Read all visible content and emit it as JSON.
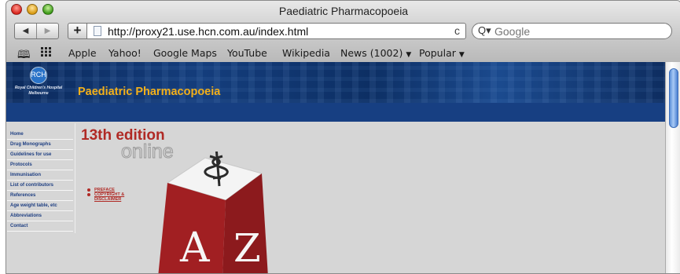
{
  "window": {
    "title": "Paediatric Pharmacopoeia"
  },
  "toolbar": {
    "back_icon": "back-arrow-icon",
    "forward_icon": "forward-arrow-icon",
    "add_label": "+",
    "url": "http://proxy21.use.hcn.com.au/index.html",
    "reload_glyph": "c",
    "search_placeholder": "Google"
  },
  "bookmarks": {
    "items": [
      {
        "label": "Apple"
      },
      {
        "label": "Yahoo!"
      },
      {
        "label": "Google Maps"
      },
      {
        "label": "YouTube"
      },
      {
        "label": "Wikipedia"
      },
      {
        "label": "News (1002)",
        "menu": true
      },
      {
        "label": "Popular",
        "menu": true
      }
    ]
  },
  "page": {
    "logo_text": "RCH",
    "hospital_line1": "Royal Children's Hospital",
    "hospital_line2": "Melbourne",
    "title": "Paediatric Pharmacopoeia",
    "edition": "13th edition",
    "online": "online",
    "sidebar": [
      "Home",
      "Drug Monographs",
      "Guidelines for use",
      "Protocols",
      "Immunisation",
      "List of contributors",
      "References",
      "Age weight table, etc",
      "Abbreviations",
      "Contact"
    ],
    "links": [
      "PREFACE",
      "COPYRIGHT &\nDISCLAIMER"
    ],
    "cube_letters": [
      "A",
      "Z"
    ]
  },
  "colors": {
    "accent_red": "#b02a25",
    "banner_blue": "#143d7c",
    "title_gold": "#f3b01a",
    "nav_text": "#1d3e82"
  }
}
